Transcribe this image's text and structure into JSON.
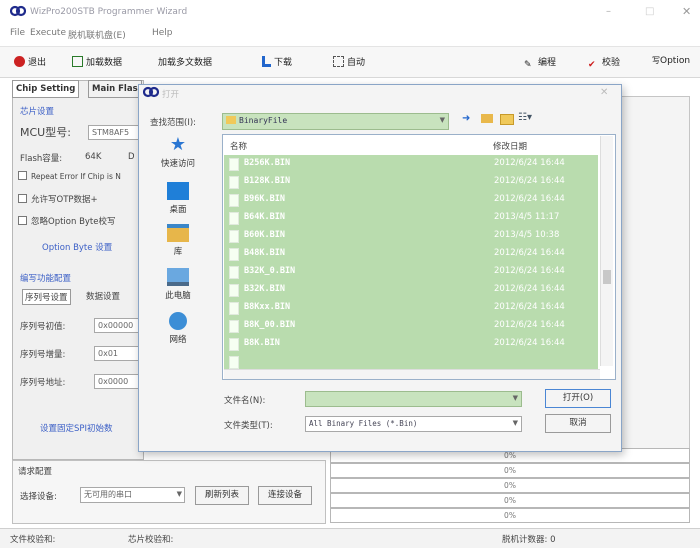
{
  "window": {
    "title": "WizPro200STB Programmer Wizard"
  },
  "menu": [
    "File",
    "Execute",
    "脱机联机盘(E)",
    "Help"
  ],
  "toolbar": [
    {
      "label": "退出",
      "icon": "exit-icon",
      "color": "#cc2222"
    },
    {
      "label": "加载数据",
      "icon": "load-icon",
      "color": "#2a7a2a"
    },
    {
      "label": "加载多文数据",
      "icon": "",
      "color": "#333333"
    },
    {
      "label": "下载",
      "icon": "download-icon",
      "color": "#2266cc"
    },
    {
      "label": "自动",
      "icon": "auto-icon",
      "color": "#555555"
    },
    {
      "label": "编程",
      "icon": "program-icon",
      "color": "#222222"
    },
    {
      "label": "校验",
      "icon": "verify-icon",
      "color": "#cc1a1a"
    },
    {
      "label": "Option",
      "icon": "option-icon",
      "color": "#555555"
    }
  ],
  "tabs": [
    "Chip Setting",
    "Main Flas"
  ],
  "chip": {
    "group_label": "芯片设置",
    "mcu_label": "MCU型号:",
    "mcu_value": "STM8AF5",
    "flash_label": "Flash容量:",
    "flash_value": "64K",
    "flash_extra": "D",
    "options": [
      "Repeat Error If Chip is N",
      "允许写OTP数据+",
      "忽略Option Byte校写"
    ],
    "option_byte_link": "Option Byte 设置"
  },
  "serial": {
    "group_label": "编写功能配置",
    "tabs": [
      "序列号设置",
      "数据设置"
    ],
    "rows": [
      {
        "label": "序列号初值:",
        "value": "0x00000"
      },
      {
        "label": "序列号增量:",
        "value": "0x01"
      },
      {
        "label": "序列号地址:",
        "value": "0x0000"
      }
    ],
    "spi_link": "设置固定SPI初始数"
  },
  "device": {
    "group_label": "请求配置",
    "select_label": "选择设备:",
    "select_value": "无可用的串口",
    "refresh_button": "刷新列表",
    "connect_button": "连接设备"
  },
  "progress": [
    "0%",
    "0%",
    "0%",
    "0%",
    "0%"
  ],
  "status": {
    "file_checksum": "文件校验和:",
    "chip_checksum": "芯片校验和:",
    "counter_label": "脱机计数器: 0"
  },
  "dialog": {
    "title": "打开",
    "lookin_label": "查找范围(I):",
    "lookin_value": "BinaryFile",
    "places": [
      "快速访问",
      "桌面",
      "库",
      "此电脑",
      "网络"
    ],
    "col_name": "名称",
    "col_date": "修改日期",
    "files": [
      {
        "name": "B256K.BIN",
        "date": "2012/6/24 16:44"
      },
      {
        "name": "B128K.BIN",
        "date": "2012/6/24 16:44"
      },
      {
        "name": "B96K.BIN",
        "date": "2012/6/24 16:44"
      },
      {
        "name": "B64K.BIN",
        "date": "2013/4/5 11:17"
      },
      {
        "name": "B60K.BIN",
        "date": "2013/4/5 10:38"
      },
      {
        "name": "B48K.BIN",
        "date": "2012/6/24 16:44"
      },
      {
        "name": "B32K_0.BIN",
        "date": "2012/6/24 16:44"
      },
      {
        "name": "B32K.BIN",
        "date": "2012/6/24 16:44"
      },
      {
        "name": "B8Kxx.BIN",
        "date": "2012/6/24 16:44"
      },
      {
        "name": "B8K_00.BIN",
        "date": "2012/6/24 16:44"
      },
      {
        "name": "B8K.BIN",
        "date": "2012/6/24 16:44"
      }
    ],
    "filename_label": "文件名(N):",
    "filename_value": "",
    "filetype_label": "文件类型(T):",
    "filetype_value": "All Binary Files (*.Bin)",
    "open_button": "打开(O)",
    "cancel_button": "取消"
  }
}
